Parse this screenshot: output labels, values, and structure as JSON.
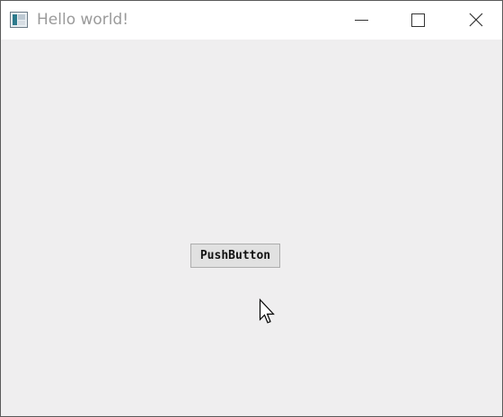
{
  "window": {
    "title": "Hello world!",
    "background_color": "#efeeef",
    "titlebar_color": "#ffffff",
    "title_color": "#9a9a9a"
  },
  "titlebar_controls": {
    "minimize_icon": "minimize-icon",
    "maximize_icon": "maximize-icon",
    "close_icon": "close-icon"
  },
  "content": {
    "push_button_label": "PushButton"
  },
  "cursor_icon": "mouse-pointer-icon"
}
